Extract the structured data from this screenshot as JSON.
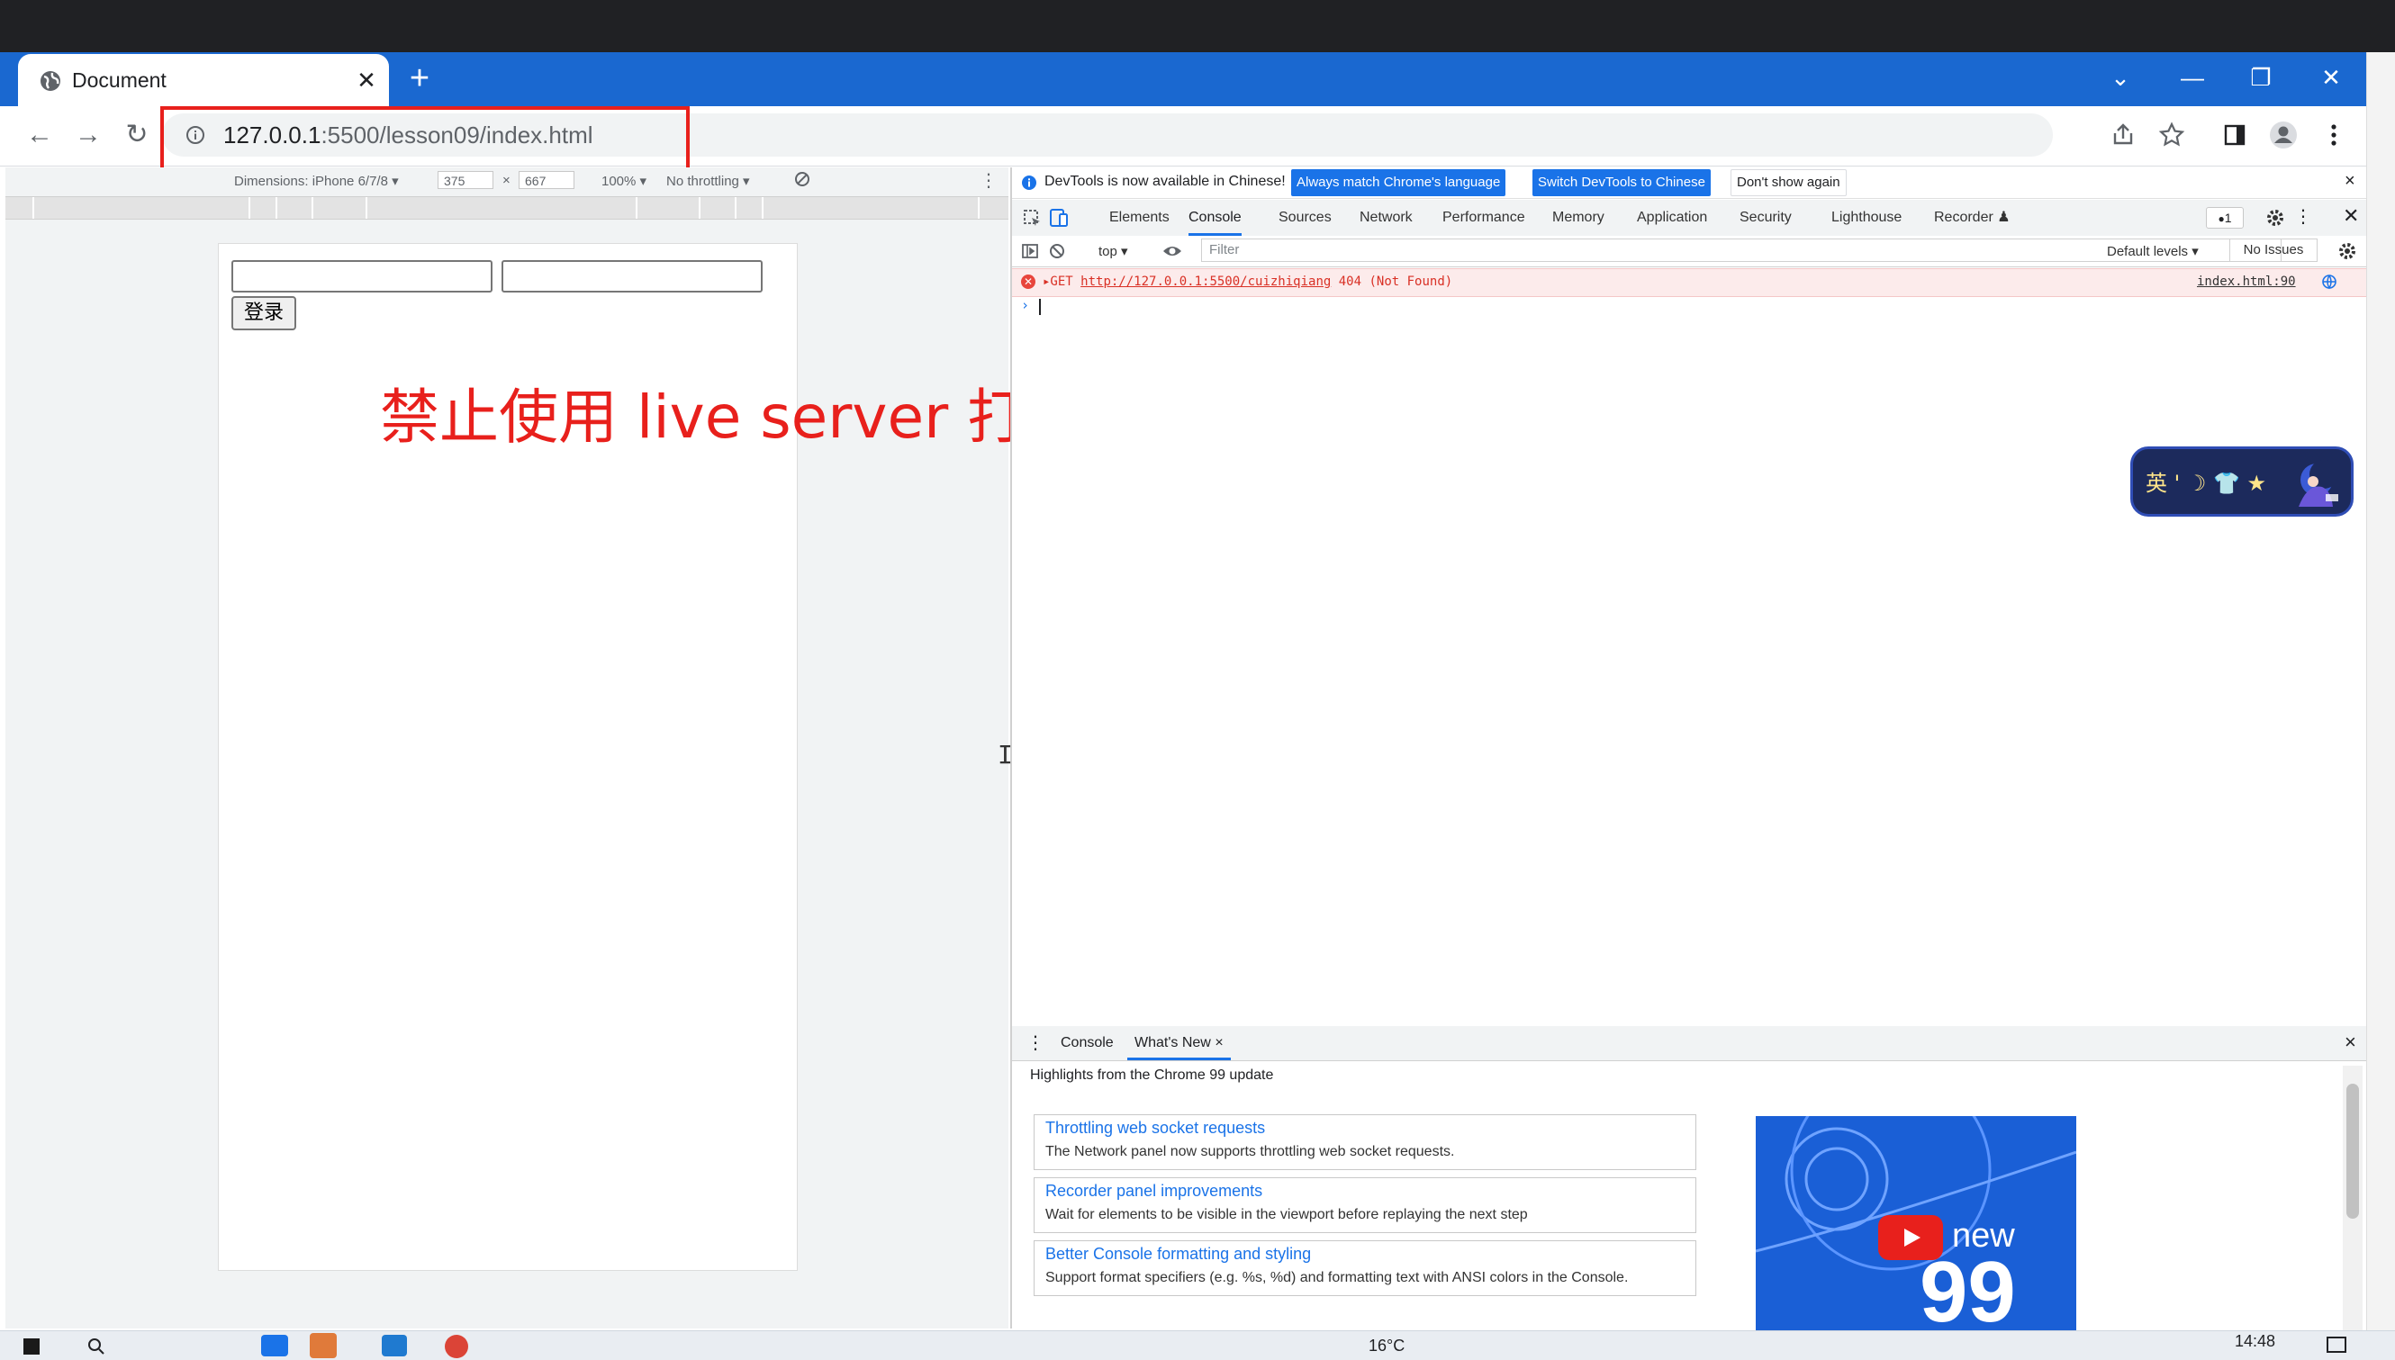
{
  "browser": {
    "tab_title": "Document",
    "tab_close": "✕",
    "new_tab": "+",
    "window_controls": [
      "⌄",
      "—",
      "❐",
      "✕"
    ],
    "url_host": "127.0.0.1",
    "url_rest": ":5500/lesson09/index.html",
    "nav": {
      "back": "←",
      "forward": "→",
      "reload": "↻"
    },
    "toolbar_icons": [
      "share-icon",
      "star-icon",
      "sidepanel-icon",
      "profile-icon",
      "menu-icon"
    ]
  },
  "device_toolbar": {
    "dimensions_label": "Dimensions: iPhone 6/7/8 ▾",
    "width": "375",
    "times": "×",
    "height": "667",
    "zoom": "100% ▾",
    "throttling": "No throttling ▾",
    "more": "⋮"
  },
  "viewport_page": {
    "login_button": "登录",
    "overlay_note": "禁止使用 live server 打开页面"
  },
  "devtools": {
    "info_message": "DevTools is now available in Chinese!",
    "info_btn_match": "Always match Chrome's language",
    "info_btn_switch": "Switch DevTools to Chinese",
    "info_btn_dismiss": "Don't show again",
    "info_close": "×",
    "tabs": [
      "Elements",
      "Console",
      "Sources",
      "Network",
      "Performance",
      "Memory",
      "Application",
      "Security",
      "Lighthouse",
      "Recorder ♟"
    ],
    "issues_count": "1",
    "context": "top ▾",
    "filter_placeholder": "Filter",
    "levels": "Default levels ▾",
    "issues": "No Issues",
    "error": {
      "prefix": "▸GET ",
      "url": "http://127.0.0.1:5500/cuizhiqiang",
      "status": " 404 (Not Found)",
      "source": "index.html:90"
    },
    "prompt": "›"
  },
  "ime": {
    "label": "英 ' ☽ 👕 ★"
  },
  "drawer": {
    "tab_console": "Console",
    "tab_whats_new": "What's New",
    "tab_close": "×",
    "close": "×",
    "highlights": "Highlights from the Chrome 99 update",
    "cards": [
      {
        "title": "Throttling web socket requests",
        "desc": "The Network panel now supports throttling web socket requests."
      },
      {
        "title": "Recorder panel improvements",
        "desc": "Wait for elements to be visible in the viewport before replaying the next step"
      },
      {
        "title": "Better Console formatting and styling",
        "desc": "Support format specifiers (e.g. %s, %d) and formatting text with ANSI colors in the Console."
      }
    ],
    "video_new": "new",
    "video_version": "99"
  },
  "taskbar": {
    "weather": "16°C",
    "clock": "14:48"
  }
}
